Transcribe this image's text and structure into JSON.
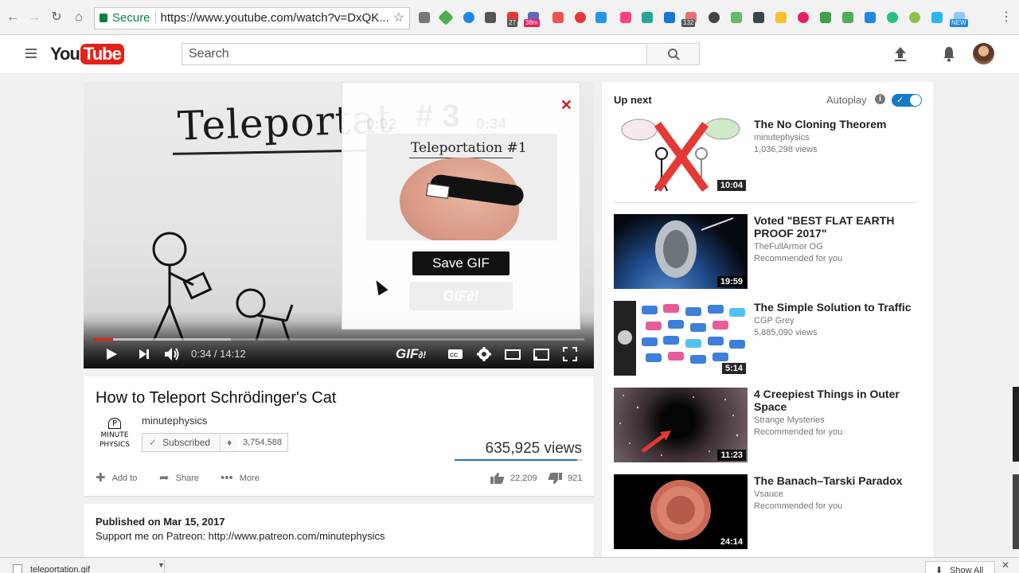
{
  "browser": {
    "secure_label": "Secure",
    "url": "https://www.youtube.com/watch?v=DxQK...",
    "ext_badges": [
      "27",
      "38m",
      "132",
      "NEW"
    ]
  },
  "header": {
    "logo_you": "You",
    "logo_tube": "Tube",
    "search_placeholder": "Search"
  },
  "player": {
    "whiteboard_title": "Teleportat",
    "time_display": "0:34 / 14:12",
    "progress_played": 0.04,
    "progress_buffered": 0.28,
    "gif_button_label": "GIF"
  },
  "gif_popup": {
    "ghost_start": "0:02",
    "ghost_number": "# 3",
    "ghost_end": "0:34",
    "preview_title": "Teleportation #1",
    "save_label": "Save GIF",
    "ghost_gif_label": "GIF"
  },
  "video": {
    "title": "How to Teleport Schrödinger's Cat",
    "channel": "minutephysics",
    "channel_logo_text": "MINUTE PHYSICS",
    "subscribed_label": "Subscribed",
    "subscriber_count": "3,754,588",
    "views": "635,925 views",
    "add_to_label": "Add to",
    "share_label": "Share",
    "more_label": "More",
    "likes": "22,209",
    "dislikes": "921",
    "published": "Published on Mar 15, 2017",
    "support_text": "Support me on Patreon: http://www.patreon.com/minutephysics"
  },
  "sidebar": {
    "up_next_label": "Up next",
    "autoplay_label": "Autoplay",
    "autoplay_on": true,
    "videos": [
      {
        "title": "The No Cloning Theorem",
        "channel": "minutephysics",
        "meta": "1,036,298 views",
        "duration": "10:04"
      },
      {
        "title": "Voted \"BEST FLAT EARTH PROOF 2017\"",
        "channel": "TheFullArmor OG",
        "meta": "Recommended for you",
        "duration": "19:59"
      },
      {
        "title": "The Simple Solution to Traffic",
        "channel": "CGP Grey",
        "meta": "5,885,090 views",
        "duration": "5:14"
      },
      {
        "title": "4 Creepiest Things in Outer Space",
        "channel": "Strange Mysteries",
        "meta": "Recommended for you",
        "duration": "11:23"
      },
      {
        "title": "The Banach–Tarski Paradox",
        "channel": "Vsauce",
        "meta": "Recommended for you",
        "duration": "24:14"
      }
    ]
  },
  "downloads": {
    "file_name": "teleportation.gif",
    "show_all_label": "Show All"
  },
  "colors": {
    "brand_red": "#e62117",
    "accent_blue": "#167ac6"
  }
}
